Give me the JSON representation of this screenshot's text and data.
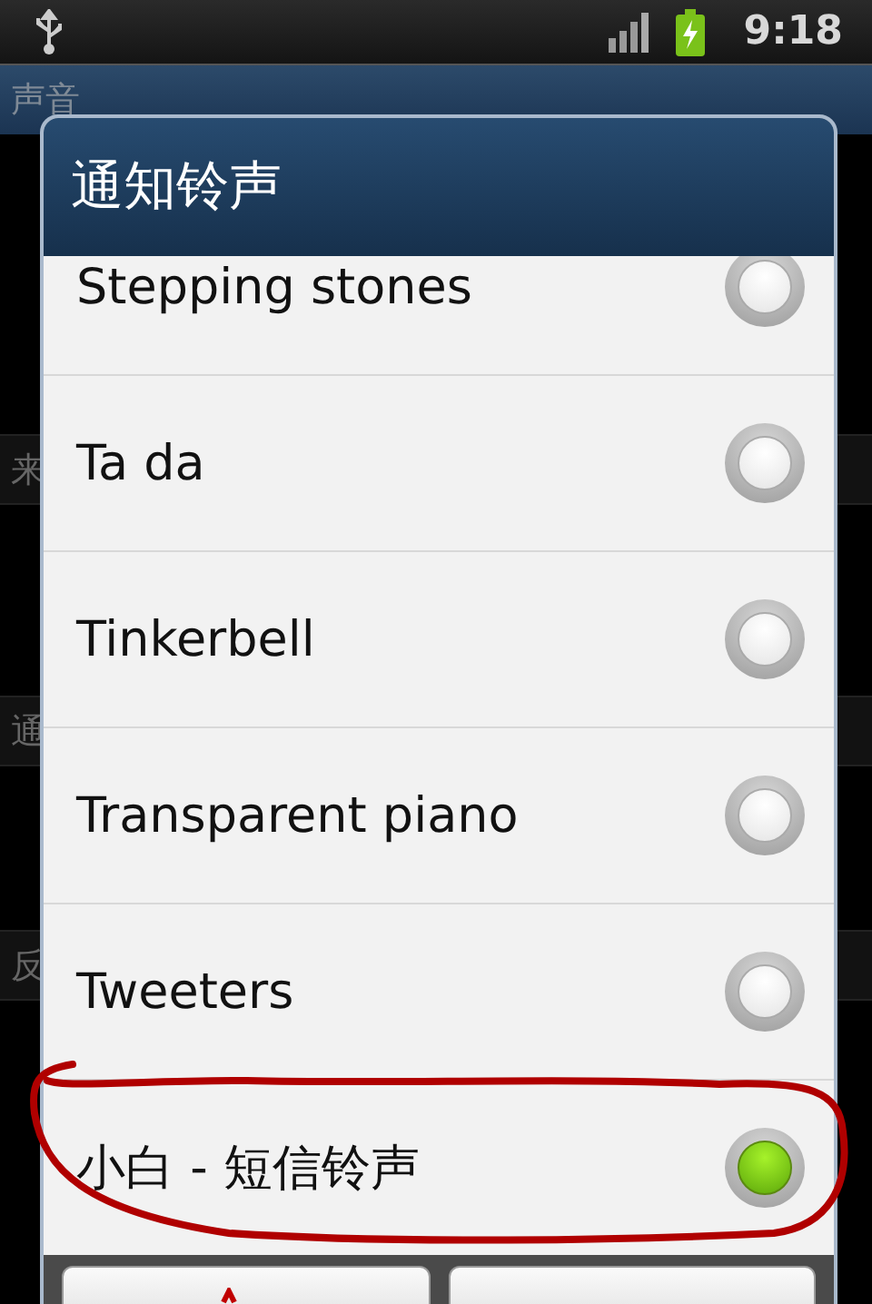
{
  "status_bar": {
    "time": "9:18"
  },
  "background": {
    "title": "声音",
    "sections": [
      {
        "label": "来"
      },
      {
        "label": "通"
      },
      {
        "label": "反"
      }
    ]
  },
  "dialog": {
    "title": "通知铃声",
    "options": [
      {
        "label": "Stepping stones",
        "selected": false
      },
      {
        "label": "Ta da",
        "selected": false
      },
      {
        "label": "Tinkerbell",
        "selected": false
      },
      {
        "label": "Transparent piano",
        "selected": false
      },
      {
        "label": "Tweeters",
        "selected": false
      },
      {
        "label": "小白 - 短信铃声",
        "selected": true
      }
    ]
  }
}
